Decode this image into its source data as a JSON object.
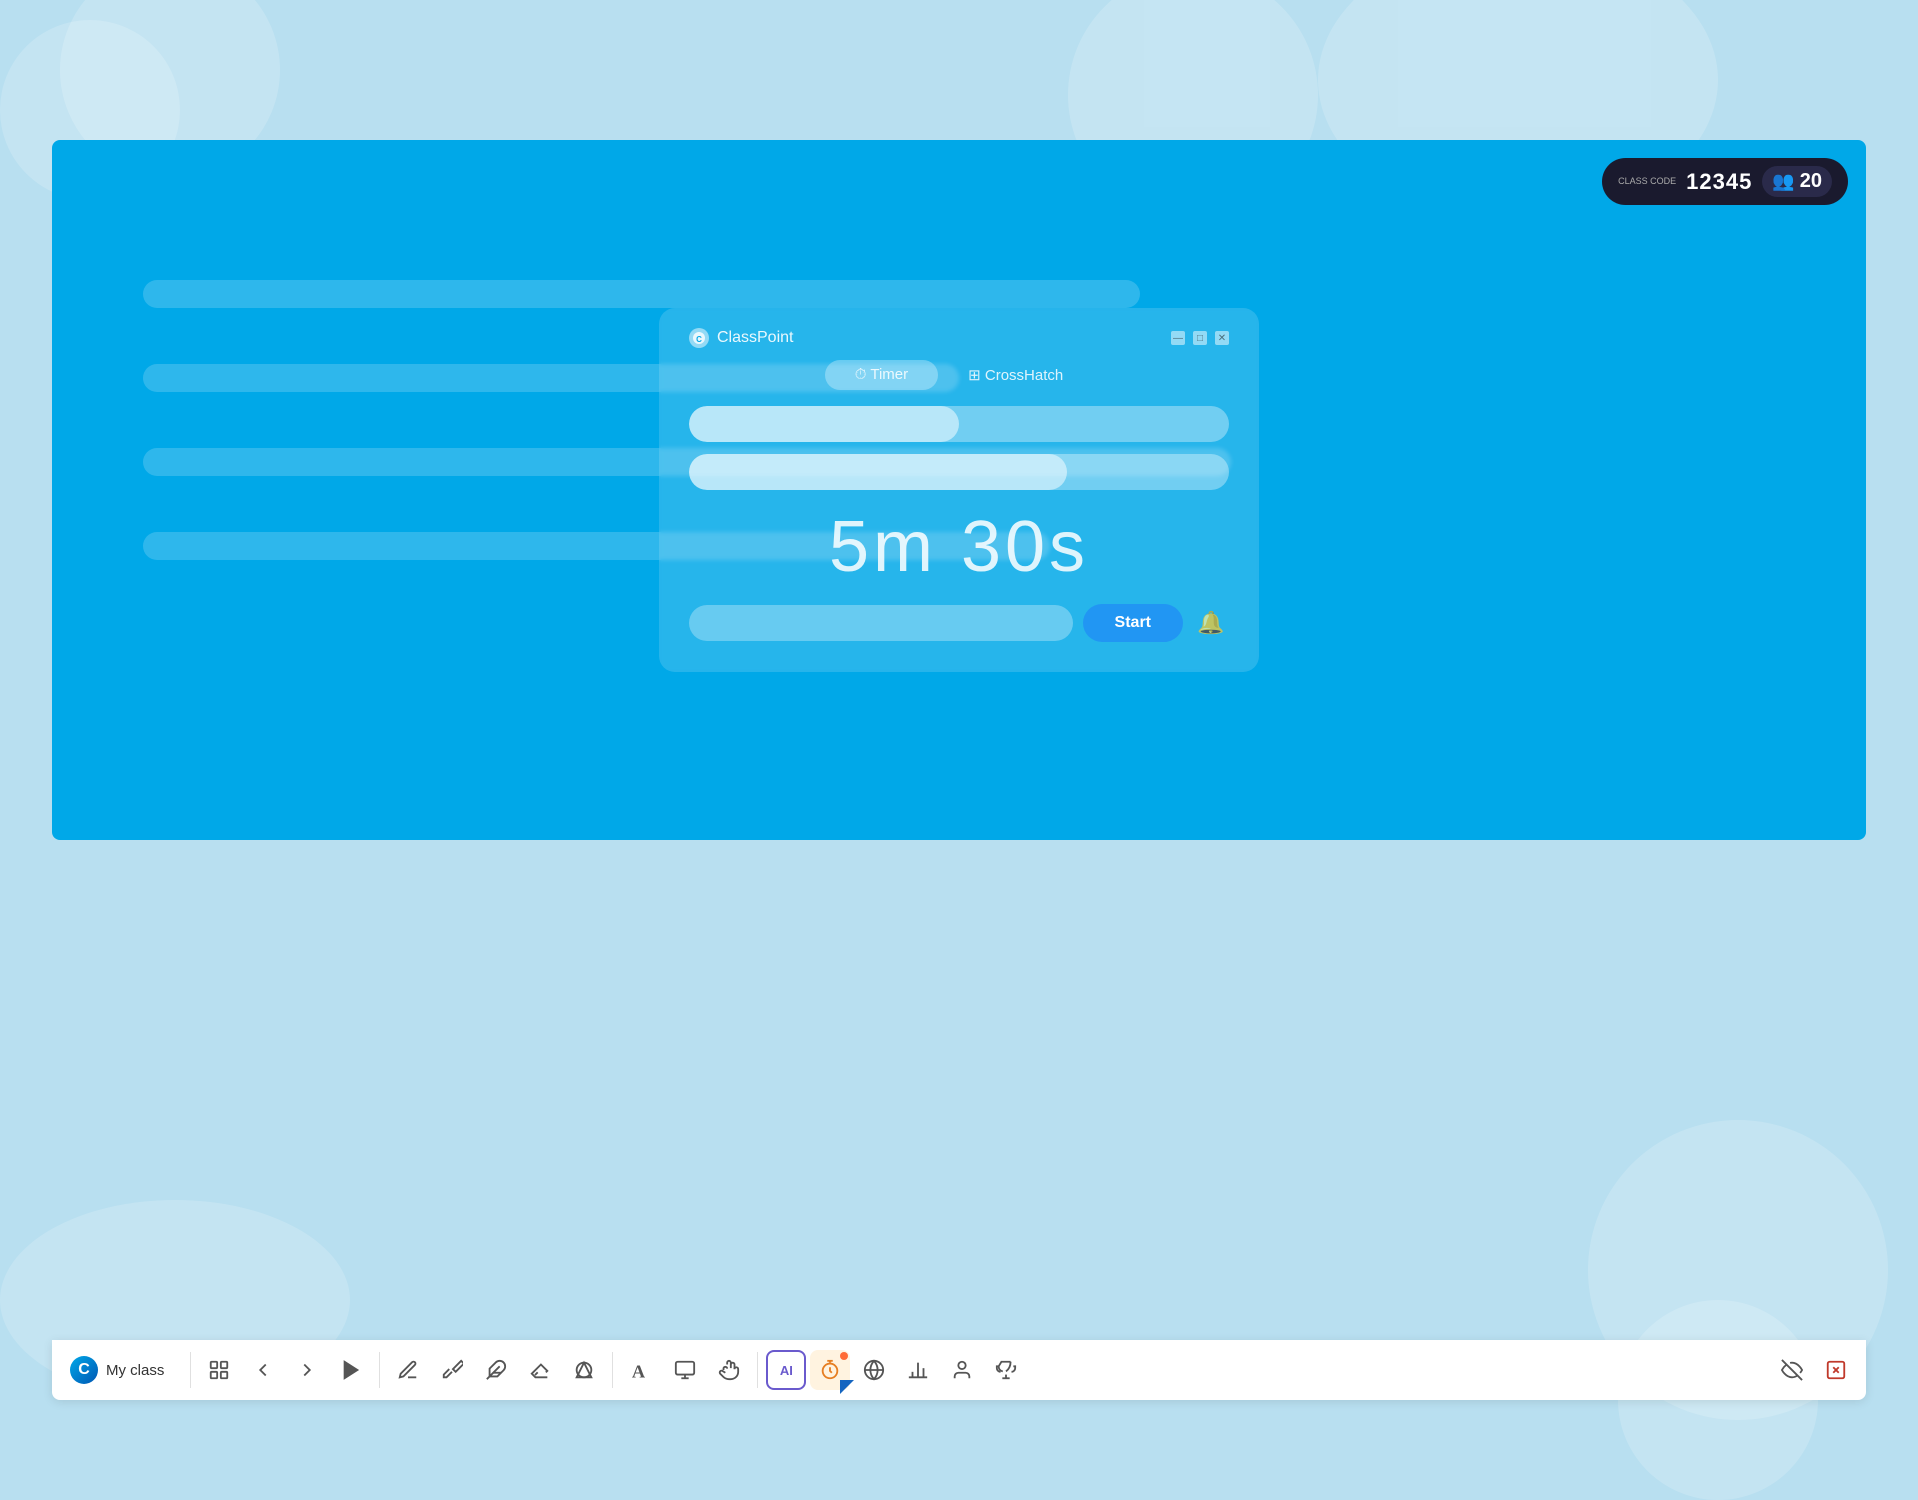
{
  "app": {
    "title": "ClassPoint",
    "class_name": "My class"
  },
  "background_bubbles": [
    {
      "class": "bubble1"
    },
    {
      "class": "bubble2"
    },
    {
      "class": "bubble3"
    },
    {
      "class": "bubble4"
    },
    {
      "class": "bubble5"
    },
    {
      "class": "bubble6"
    },
    {
      "class": "bubble7"
    }
  ],
  "class_badge": {
    "label": "class\ncode",
    "code": "12345",
    "participants_count": "20",
    "participants_icon": "👥"
  },
  "timer_popup": {
    "title": "ClassPoint",
    "tabs": [
      {
        "label": "Timer",
        "active": true
      },
      {
        "label": "CrossHatch",
        "active": false
      }
    ],
    "window_controls": [
      "—",
      "□",
      "✕"
    ],
    "timer_value": "5m 30s",
    "start_button_label": "Start"
  },
  "toolbar": {
    "logo_letter": "C",
    "class_name": "My class",
    "buttons": [
      {
        "name": "grid-view",
        "icon": "⊞",
        "label": "Grid View"
      },
      {
        "name": "back",
        "icon": "←",
        "label": "Back"
      },
      {
        "name": "forward",
        "icon": "→",
        "label": "Forward"
      },
      {
        "name": "play",
        "icon": "▶",
        "label": "Play"
      },
      {
        "name": "pen",
        "icon": "✏",
        "label": "Pen"
      },
      {
        "name": "highlighter",
        "icon": "🖊",
        "label": "Highlighter"
      },
      {
        "name": "highlight-pen",
        "icon": "✒",
        "label": "Highlight Pen"
      },
      {
        "name": "eraser",
        "icon": "◻",
        "label": "Eraser"
      },
      {
        "name": "shapes",
        "icon": "⬡",
        "label": "Shapes"
      },
      {
        "name": "text",
        "icon": "A",
        "label": "Text"
      },
      {
        "name": "whiteboard",
        "icon": "📋",
        "label": "Whiteboard"
      },
      {
        "name": "drag",
        "icon": "✋",
        "label": "Drag"
      },
      {
        "name": "ai",
        "icon": "AI",
        "label": "AI Assistant"
      },
      {
        "name": "timer",
        "icon": "⏱",
        "label": "Timer",
        "active": true
      },
      {
        "name": "globe",
        "icon": "🌐",
        "label": "Globe"
      },
      {
        "name": "chart",
        "icon": "📊",
        "label": "Chart"
      },
      {
        "name": "user",
        "icon": "👤",
        "label": "User"
      },
      {
        "name": "trophy",
        "icon": "🏆",
        "label": "Trophy"
      }
    ],
    "right_buttons": [
      {
        "name": "hide",
        "icon": "👁",
        "label": "Hide"
      },
      {
        "name": "exit",
        "icon": "✕",
        "label": "Exit"
      }
    ]
  }
}
